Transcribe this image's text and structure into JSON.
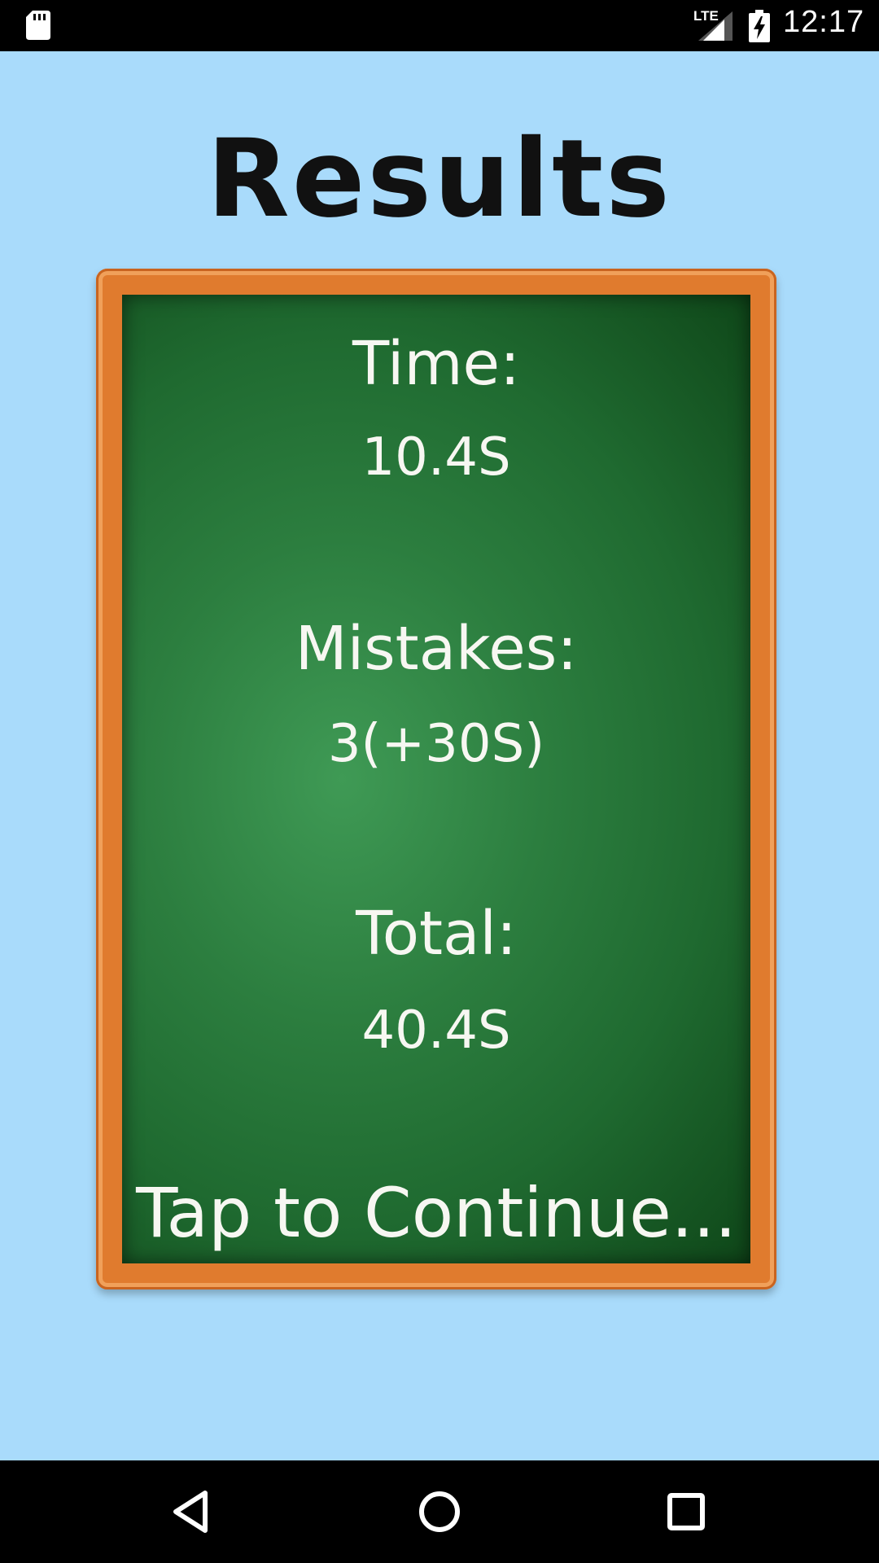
{
  "status_bar": {
    "network": "LTE",
    "time": "12:17",
    "icons": [
      "sd-card-icon",
      "signal-icon",
      "battery-charging-icon"
    ]
  },
  "screen": {
    "title": "Results",
    "board": {
      "time_label": "Time:",
      "time_value": "10.4S",
      "mistakes_label": "Mistakes:",
      "mistakes_value": "3(+30S)",
      "total_label": "Total:",
      "total_value": "40.4S",
      "continue_label": "Tap to Continue..."
    }
  },
  "nav_bar": {
    "buttons": [
      "back-icon",
      "home-icon",
      "recents-icon"
    ]
  },
  "colors": {
    "background": "#a9dbfb",
    "frame": "#e07b2e",
    "board": "#2c7e3f",
    "chalk": "#f7f7f2"
  }
}
